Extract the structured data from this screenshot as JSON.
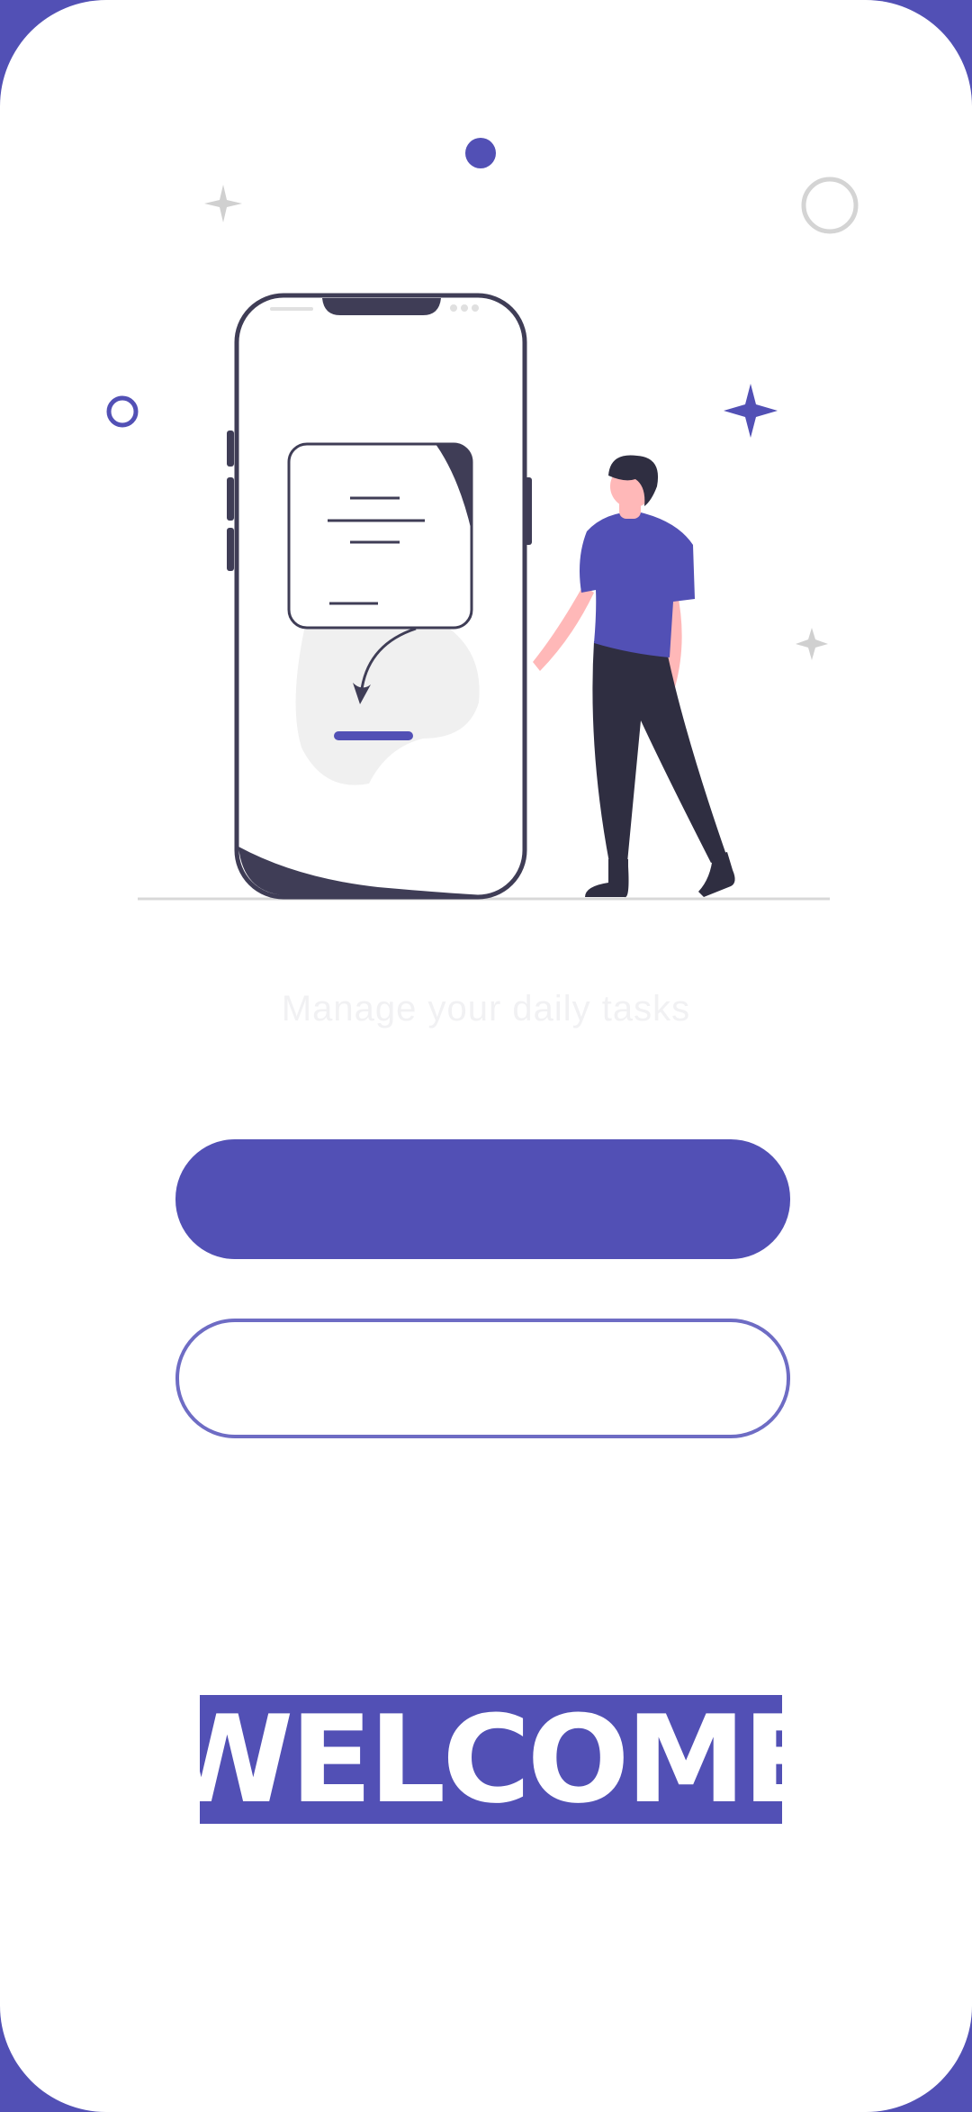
{
  "illustration": {
    "accent_color": "#5250b5",
    "icons": [
      "phone-illustration",
      "person-illustration",
      "download-arrow-icon",
      "sparkle-icon",
      "circle-icon",
      "dot-icon"
    ]
  },
  "tagline": "Manage your daily tasks",
  "buttons": {
    "primary_label": "",
    "secondary_label": ""
  },
  "welcome": "WELCOME",
  "colors": {
    "accent": "#5250b5",
    "background": "#ffffff"
  }
}
